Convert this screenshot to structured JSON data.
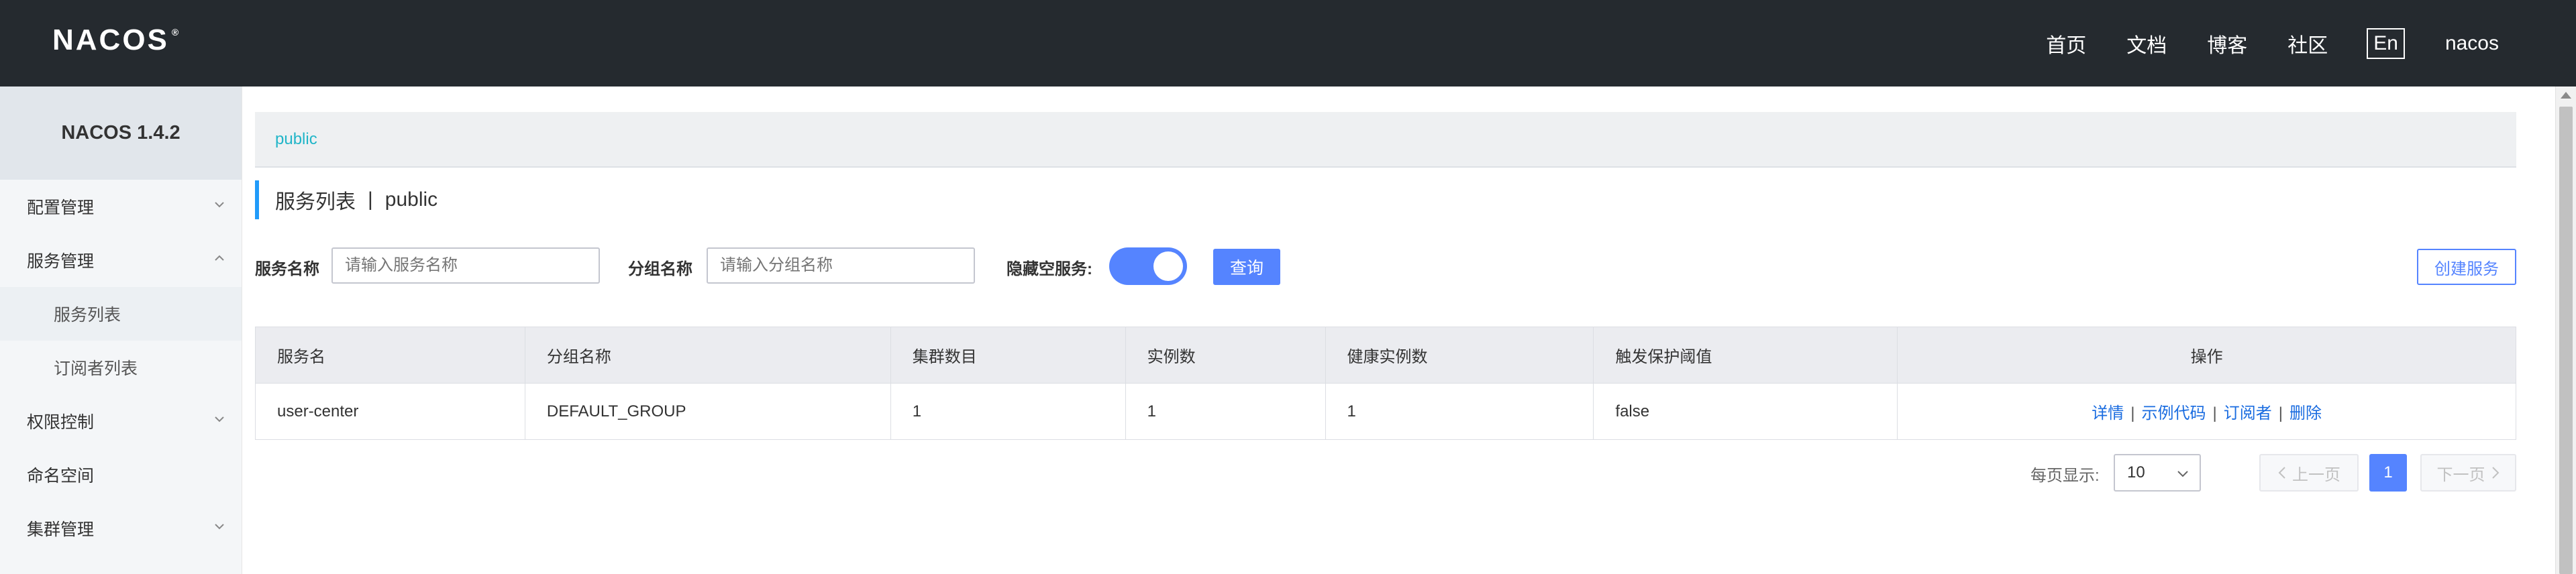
{
  "header": {
    "logo": "NACOS",
    "logo_mark": "®",
    "nav": [
      "首页",
      "文档",
      "博客",
      "社区"
    ],
    "lang": "En",
    "user": "nacos"
  },
  "sidebar": {
    "version": "NACOS 1.4.2",
    "items": [
      {
        "label": "配置管理",
        "expanded": false
      },
      {
        "label": "服务管理",
        "expanded": true
      },
      {
        "label": "服务列表",
        "sub": true,
        "active": true
      },
      {
        "label": "订阅者列表",
        "sub": true
      },
      {
        "label": "权限控制",
        "expanded": false
      },
      {
        "label": "命名空间"
      },
      {
        "label": "集群管理",
        "expanded": false
      }
    ]
  },
  "breadcrumb": {
    "namespace": "public"
  },
  "page": {
    "title": "服务列表",
    "separator": "|",
    "namespace": "public"
  },
  "filters": {
    "service_name_label": "服务名称",
    "service_name_placeholder": "请输入服务名称",
    "group_name_label": "分组名称",
    "group_name_placeholder": "请输入分组名称",
    "hide_empty_label": "隐藏空服务:",
    "hide_empty_on": true,
    "query_button": "查询",
    "create_button": "创建服务"
  },
  "table": {
    "columns": [
      "服务名",
      "分组名称",
      "集群数目",
      "实例数",
      "健康实例数",
      "触发保护阈值",
      "操作"
    ],
    "rows": [
      {
        "service": "user-center",
        "group": "DEFAULT_GROUP",
        "clusters": "1",
        "instances": "1",
        "healthy": "1",
        "protect": "false",
        "actions": [
          "详情",
          "示例代码",
          "订阅者",
          "删除"
        ],
        "action_sep": "|"
      }
    ]
  },
  "pagination": {
    "per_page_label": "每页显示:",
    "per_page": "10",
    "prev": "上一页",
    "next": "下一页",
    "current_page": "1"
  },
  "colors": {
    "topbar": "#252a2f",
    "accent": "#5584ff",
    "breadcrumb": "#20b5c8",
    "link": "#1a6ce0"
  }
}
